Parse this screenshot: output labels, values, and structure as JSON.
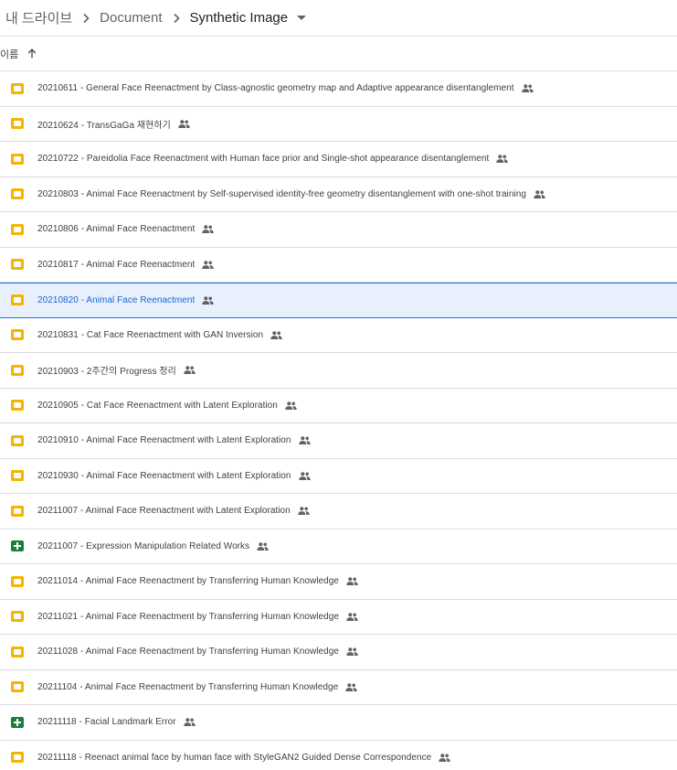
{
  "breadcrumb": {
    "items": [
      "내 드라이브",
      "Document",
      "Synthetic Image"
    ]
  },
  "list_header": {
    "name_label": "이름",
    "sort_icon": "arrow-up-icon"
  },
  "files": [
    {
      "name": "20210611 - General Face Reenactment by Class-agnostic geometry map and Adaptive appearance disentanglement",
      "type": "slides",
      "shared": true
    },
    {
      "name": "20210624 - TransGaGa 재현하기",
      "type": "slides",
      "shared": true
    },
    {
      "name": "20210722 - Pareidolia Face Reenactment with Human face prior and Single-shot appearance disentanglement",
      "type": "slides",
      "shared": true
    },
    {
      "name": "20210803 - Animal Face Reenactment by Self-supervised identity-free geometry disentanglement with one-shot training",
      "type": "slides",
      "shared": true
    },
    {
      "name": "20210806 - Animal Face Reenactment",
      "type": "slides",
      "shared": true
    },
    {
      "name": "20210817 - Animal Face Reenactment",
      "type": "slides",
      "shared": true
    },
    {
      "name": "20210820 - Animal Face Reenactment",
      "type": "slides",
      "shared": true,
      "selected": true
    },
    {
      "name": "20210831 - Cat Face Reenactment with GAN Inversion",
      "type": "slides",
      "shared": true
    },
    {
      "name": "20210903 - 2주간의 Progress 정리",
      "type": "slides",
      "shared": true
    },
    {
      "name": "20210905 - Cat Face Reenactment with Latent Exploration",
      "type": "slides",
      "shared": true
    },
    {
      "name": "20210910 - Animal Face Reenactment with Latent Exploration",
      "type": "slides",
      "shared": true
    },
    {
      "name": "20210930 - Animal Face Reenactment with Latent Exploration",
      "type": "slides",
      "shared": true
    },
    {
      "name": "20211007 - Animal Face Reenactment with Latent Exploration",
      "type": "slides",
      "shared": true
    },
    {
      "name": "20211007 - Expression Manipulation Related Works",
      "type": "sheets",
      "shared": true
    },
    {
      "name": "20211014 - Animal Face Reenactment by Transferring Human Knowledge",
      "type": "slides",
      "shared": true
    },
    {
      "name": "20211021 - Animal Face Reenactment by Transferring Human Knowledge",
      "type": "slides",
      "shared": true
    },
    {
      "name": "20211028 - Animal Face Reenactment by Transferring Human Knowledge",
      "type": "slides",
      "shared": true
    },
    {
      "name": "20211104 - Animal Face Reenactment by Transferring Human Knowledge",
      "type": "slides",
      "shared": true
    },
    {
      "name": "20211118 - Facial Landmark Error",
      "type": "sheets",
      "shared": true
    },
    {
      "name": "20211118 - Reenact animal face by human face with StyleGAN2 Guided Dense Correspondence",
      "type": "slides",
      "shared": true
    }
  ],
  "colors": {
    "slides_icon": "#f6b400",
    "sheets_icon": "#188038",
    "selected_bg": "#e8f0fe",
    "selected_border": "#1a73e8",
    "selected_text": "#1967d2"
  },
  "icons": {
    "shared": "people-icon",
    "breadcrumb_separator": "chevron-right-icon",
    "folder_menu": "caret-down-icon"
  }
}
